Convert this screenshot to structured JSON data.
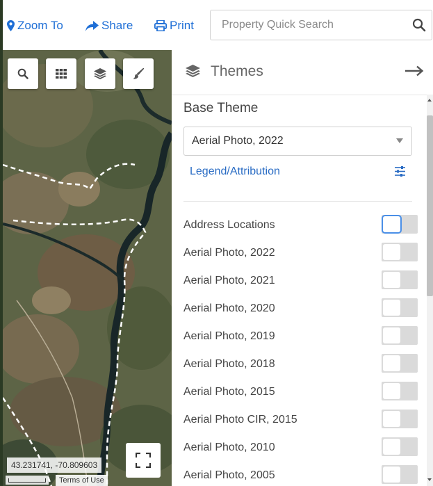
{
  "toolbar": {
    "zoom_to": "Zoom To",
    "share": "Share",
    "print": "Print",
    "search_placeholder": "Property Quick Search",
    "icons": [
      "map-marker-icon",
      "share-arrow-icon",
      "printer-icon",
      "search-icon"
    ],
    "link_color": "#1f6fd6"
  },
  "map": {
    "tools": [
      "search-icon",
      "grid-icon",
      "layers-icon",
      "paintbrush-icon"
    ],
    "coordinates": "43.231741, -70.809603",
    "terms": "Terms of Use"
  },
  "themes": {
    "title": "Themes",
    "base_label": "Base Theme",
    "base_value": "Aerial Photo, 2022",
    "legend_link": "Legend/Attribution",
    "layers": [
      {
        "label": "Address Locations",
        "on": false
      },
      {
        "label": "Aerial Photo, 2022",
        "on": false
      },
      {
        "label": "Aerial Photo, 2021",
        "on": false
      },
      {
        "label": "Aerial Photo, 2020",
        "on": false
      },
      {
        "label": "Aerial Photo, 2019",
        "on": false
      },
      {
        "label": "Aerial Photo, 2018",
        "on": false
      },
      {
        "label": "Aerial Photo, 2015",
        "on": false
      },
      {
        "label": "Aerial Photo CIR, 2015",
        "on": false
      },
      {
        "label": "Aerial Photo, 2010",
        "on": false
      },
      {
        "label": "Aerial Photo, 2005",
        "on": false
      }
    ]
  }
}
